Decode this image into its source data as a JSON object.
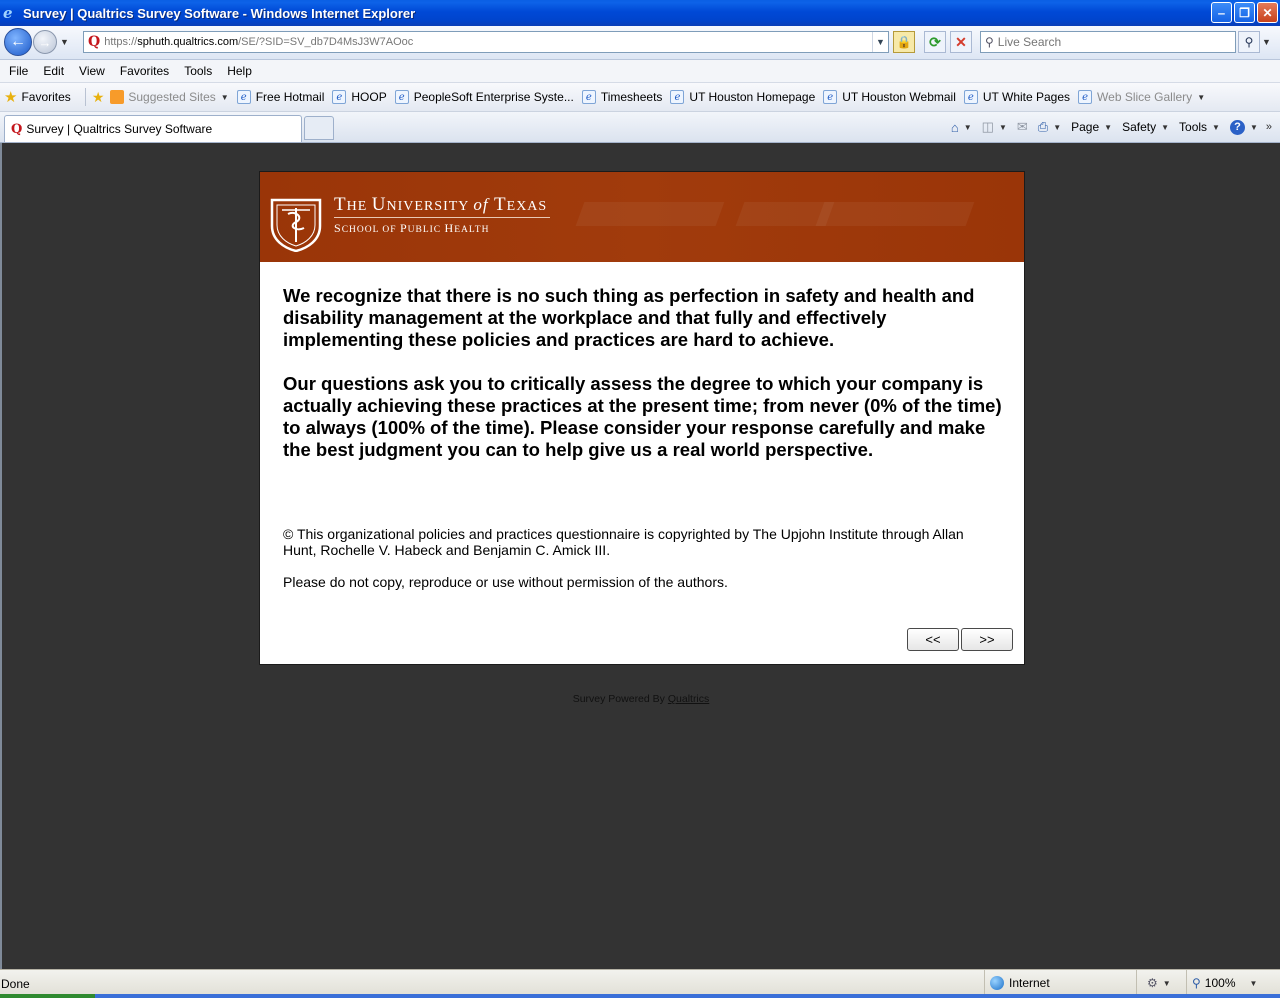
{
  "window": {
    "title": "Survey | Qualtrics Survey Software - Windows Internet Explorer",
    "minimize": "‒",
    "restore": "❐",
    "close": "✕"
  },
  "address_bar": {
    "url_prefix": "https://",
    "url_domain": "sphuth.qualtrics.com",
    "url_path": "/SE/?SID=SV_db7D4MsJ3W7AOoc"
  },
  "search": {
    "placeholder": "Live Search"
  },
  "menu": {
    "items": [
      "File",
      "Edit",
      "View",
      "Favorites",
      "Tools",
      "Help"
    ]
  },
  "favorites_bar": {
    "label": "Favorites",
    "suggested_sites": "Suggested Sites",
    "links": [
      "Free Hotmail",
      "HOOP",
      "PeopleSoft Enterprise Syste...",
      "Timesheets",
      "UT Houston Homepage",
      "UT Houston Webmail",
      "UT White Pages"
    ],
    "web_slice_gallery": "Web Slice Gallery"
  },
  "tabs": {
    "active_label": "Survey | Qualtrics Survey Software"
  },
  "command_bar": {
    "page": "Page",
    "safety": "Safety",
    "tools": "Tools"
  },
  "banner": {
    "line1_the": "T",
    "line1_he": "HE ",
    "line1_u": "U",
    "line1_niversity": "NIVERSITY ",
    "line1_of": "of",
    "line1_t": " T",
    "line1_exas": "EXAS",
    "line2_s": "S",
    "line2_chool": "CHOOL OF ",
    "line2_p": "P",
    "line2_ublic": "UBLIC ",
    "line2_h": "H",
    "line2_ealth": "EALTH"
  },
  "survey": {
    "paragraph1": "We recognize that there is no such thing as perfection in safety and health and disability management at the workplace and that fully and effectively implementing these policies and practices are hard to achieve.",
    "paragraph2": "Our questions ask you to critically assess the degree to which your company is actually achieving these practices at the present time; from never (0% of the time) to always (100% of the time). Please consider your response carefully and make the best judgment you can to help give us a real world perspective.",
    "copyright": "© This organizational policies and practices questionnaire is copyrighted by The Upjohn Institute through Allan Hunt, Rochelle V. Habeck and Benjamin C. Amick III.",
    "permission": "Please do not copy, reproduce or use without permission of the authors.",
    "prev_label": "<<",
    "next_label": ">>"
  },
  "footer": {
    "powered_by": "Survey Powered By ",
    "qualtrics_link": "Qualtrics"
  },
  "status_bar": {
    "status": "Done",
    "zone": "Internet",
    "zoom": "100%"
  }
}
